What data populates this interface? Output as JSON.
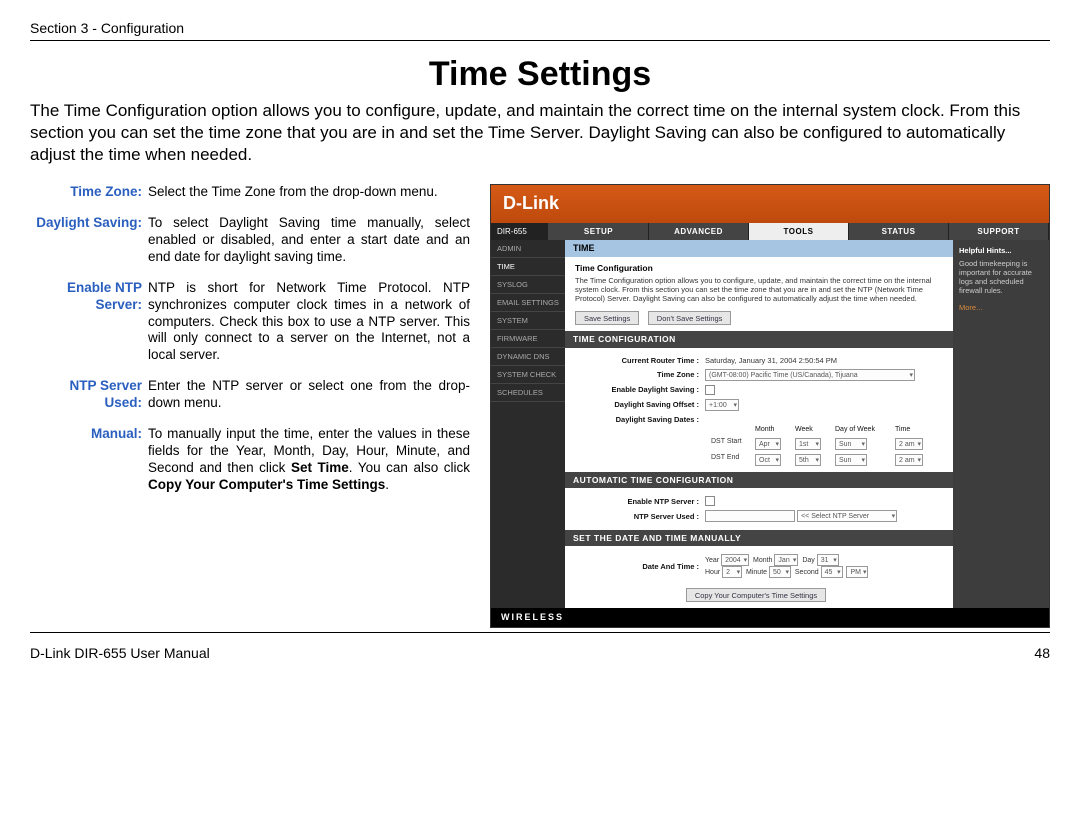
{
  "section_header": "Section 3 - Configuration",
  "page_title": "Time Settings",
  "intro": "The Time Configuration option allows you to configure, update, and maintain the correct time on the internal system clock. From this section you can set the time zone that you are in and set the Time Server. Daylight Saving can also be configured to automatically adjust the time when needed.",
  "definitions": {
    "time_zone": {
      "term": "Time Zone:",
      "body": "Select the Time Zone from the drop-down menu."
    },
    "daylight": {
      "term": "Daylight Saving:",
      "body": "To select Daylight Saving time manually, select enabled or disabled, and enter a start date and an end date for daylight saving time."
    },
    "enable_ntp": {
      "term": "Enable NTP Server:",
      "body": "NTP is short for Network Time Protocol. NTP synchronizes computer clock times in a network of computers. Check this box to use a NTP server. This will only connect to a server on the Internet, not a local server."
    },
    "ntp_used": {
      "term": "NTP Server Used:",
      "body": "Enter the NTP server or select one from the drop-down menu."
    },
    "manual": {
      "term": "Manual:",
      "body_prefix": "To manually input the time, enter the values in these fields for the Year, Month, Day, Hour, Minute, and Second and then click ",
      "bold1": "Set Time",
      "body_mid": ". You can also click ",
      "bold2": "Copy Your Computer's Time Settings",
      "body_suffix": "."
    }
  },
  "router": {
    "brand": "D-Link",
    "model": "DIR-655",
    "tabs": [
      "SETUP",
      "ADVANCED",
      "TOOLS",
      "STATUS",
      "SUPPORT"
    ],
    "active_tab": "TOOLS",
    "side_items": [
      "ADMIN",
      "TIME",
      "SYSLOG",
      "EMAIL SETTINGS",
      "SYSTEM",
      "FIRMWARE",
      "DYNAMIC DNS",
      "SYSTEM CHECK",
      "SCHEDULES"
    ],
    "active_side": "TIME",
    "hints_title": "Helpful Hints...",
    "hints_body": "Good timekeeping is important for accurate logs and scheduled firewall rules.",
    "hints_more": "More...",
    "panel_title": "TIME",
    "subpanel_title": "Time Configuration",
    "subpanel_text": "The Time Configuration option allows you to configure, update, and maintain the correct time on the internal system clock. From this section you can set the time zone that you are in and set the NTP (Network Time Protocol) Server. Daylight Saving can also be configured to automatically adjust the time when needed.",
    "btn_save": "Save Settings",
    "btn_dont": "Don't Save Settings",
    "sec_time_cfg": "TIME CONFIGURATION",
    "lbl_current": "Current Router Time :",
    "val_current": "Saturday, January 31, 2004 2:50:54 PM",
    "lbl_tz": "Time Zone :",
    "val_tz": "(GMT-08:00) Pacific Time (US/Canada), Tijuana",
    "lbl_enable_ds": "Enable Daylight Saving :",
    "lbl_ds_offset": "Daylight Saving Offset :",
    "val_ds_offset": "+1:00",
    "lbl_ds_dates": "Daylight Saving Dates :",
    "ds_headers": [
      "",
      "Month",
      "Week",
      "Day of Week",
      "Time"
    ],
    "ds_start_label": "DST Start",
    "ds_start": [
      "Apr",
      "1st",
      "Sun",
      "2 am"
    ],
    "ds_end_label": "DST End",
    "ds_end": [
      "Oct",
      "5th",
      "Sun",
      "2 am"
    ],
    "sec_auto": "AUTOMATIC TIME CONFIGURATION",
    "lbl_enable_ntp": "Enable NTP Server :",
    "lbl_ntp_used": "NTP Server Used :",
    "ntp_select_hint": "<< Select NTP Server",
    "sec_manual": "SET THE DATE AND TIME MANUALLY",
    "lbl_date_time": "Date And Time :",
    "dt_labels": {
      "year": "Year",
      "month": "Month",
      "day": "Day",
      "hour": "Hour",
      "minute": "Minute",
      "second": "Second"
    },
    "dt_values": {
      "year": "2004",
      "month": "Jan",
      "day": "31",
      "hour": "2",
      "minute": "50",
      "second": "45",
      "ampm": "PM"
    },
    "btn_copy": "Copy Your Computer's Time Settings",
    "footer": "WIRELESS"
  },
  "page_footer": {
    "left": "D-Link DIR-655 User Manual",
    "right": "48"
  }
}
